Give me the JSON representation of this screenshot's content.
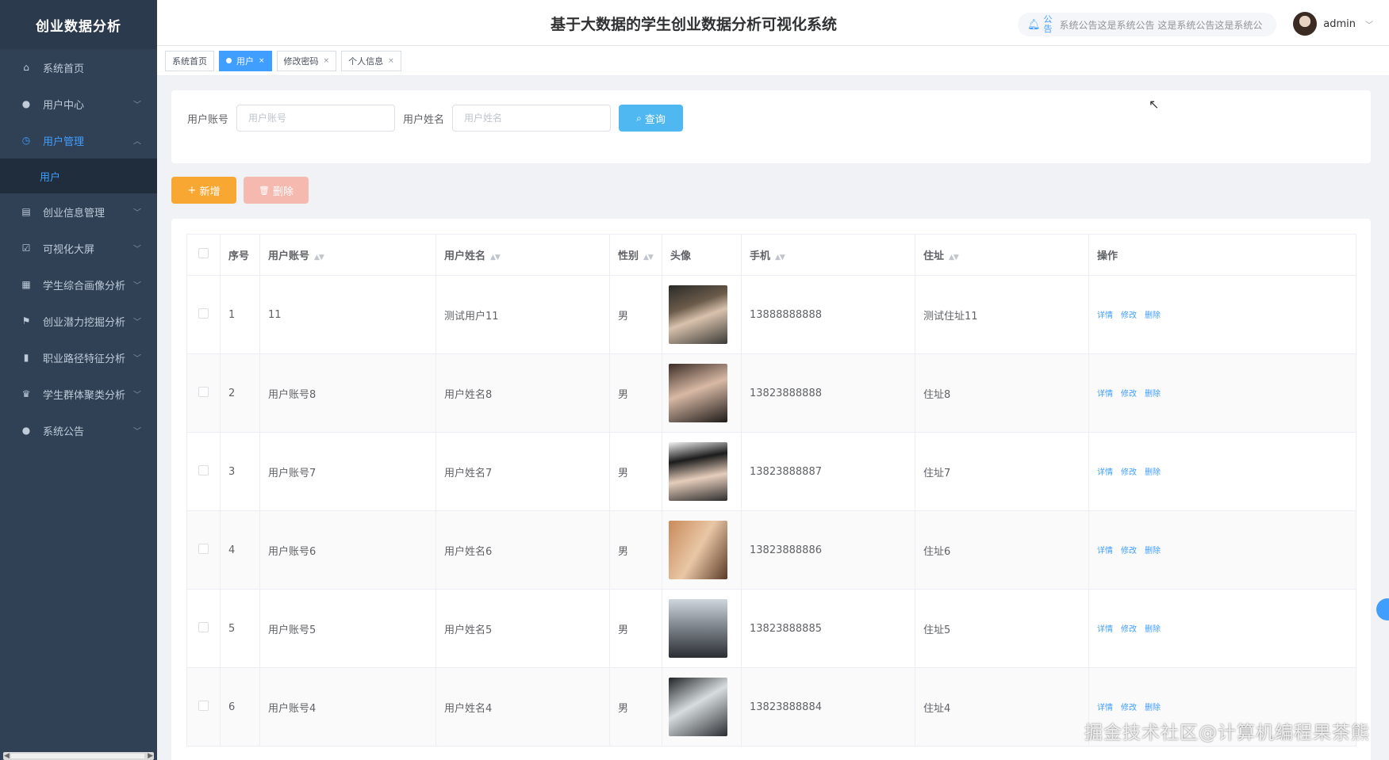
{
  "sidebar": {
    "brand": "创业数据分析",
    "items": [
      {
        "label": "系统首页",
        "icon": "home-icon",
        "chev": false
      },
      {
        "label": "用户中心",
        "icon": "user-icon",
        "chev": true
      },
      {
        "label": "用户管理",
        "icon": "clock-icon",
        "chev": true,
        "active": true
      },
      {
        "label": "创业信息管理",
        "icon": "card-icon",
        "chev": true
      },
      {
        "label": "可视化大屏",
        "icon": "check-icon",
        "chev": true
      },
      {
        "label": "学生综合画像分析",
        "icon": "clipboard-icon",
        "chev": true
      },
      {
        "label": "创业潜力挖掘分析",
        "icon": "flag-icon",
        "chev": true
      },
      {
        "label": "职业路径特征分析",
        "icon": "bar-chart-icon",
        "chev": true
      },
      {
        "label": "学生群体聚类分析",
        "icon": "trophy-icon",
        "chev": true
      },
      {
        "label": "系统公告",
        "icon": "user-icon",
        "chev": true
      }
    ],
    "sub_item": "用户"
  },
  "header": {
    "title": "基于大数据的学生创业数据分析可视化系统",
    "notice_label": "公告",
    "notice_text": "系统公告这是系统公告    这是系统公告这是系统公",
    "username": "admin"
  },
  "tags": [
    {
      "label": "系统首页",
      "closable": false,
      "active": false
    },
    {
      "label": "用户",
      "closable": true,
      "active": true
    },
    {
      "label": "修改密码",
      "closable": true,
      "active": false
    },
    {
      "label": "个人信息",
      "closable": true,
      "active": false
    }
  ],
  "search": {
    "account_label": "用户账号",
    "account_placeholder": "用户账号",
    "name_label": "用户姓名",
    "name_placeholder": "用户姓名",
    "query_button": "查询"
  },
  "actions": {
    "add": "新增",
    "delete": "删除"
  },
  "table": {
    "headers": {
      "index": "序号",
      "account": "用户账号",
      "name": "用户姓名",
      "gender": "性别",
      "avatar": "头像",
      "phone": "手机",
      "address": "住址",
      "ops": "操作"
    },
    "ops": {
      "detail": "详情",
      "edit": "修改",
      "delete": "删除"
    },
    "rows": [
      {
        "index": "1",
        "account": "11",
        "name": "测试用户11",
        "gender": "男",
        "phone": "13888888888",
        "address": "测试住址11"
      },
      {
        "index": "2",
        "account": "用户账号8",
        "name": "用户姓名8",
        "gender": "男",
        "phone": "13823888888",
        "address": "住址8"
      },
      {
        "index": "3",
        "account": "用户账号7",
        "name": "用户姓名7",
        "gender": "男",
        "phone": "13823888887",
        "address": "住址7"
      },
      {
        "index": "4",
        "account": "用户账号6",
        "name": "用户姓名6",
        "gender": "男",
        "phone": "13823888886",
        "address": "住址6"
      },
      {
        "index": "5",
        "account": "用户账号5",
        "name": "用户姓名5",
        "gender": "男",
        "phone": "13823888885",
        "address": "住址5"
      },
      {
        "index": "6",
        "account": "用户账号4",
        "name": "用户姓名4",
        "gender": "男",
        "phone": "13823888884",
        "address": "住址4"
      }
    ]
  },
  "watermark": "掘金技术社区@计算机编程果茶熊",
  "colors": {
    "sidebar": "#304156",
    "primary": "#409eff",
    "warning": "#f8a832",
    "danger_light": "#f5b9b0"
  }
}
